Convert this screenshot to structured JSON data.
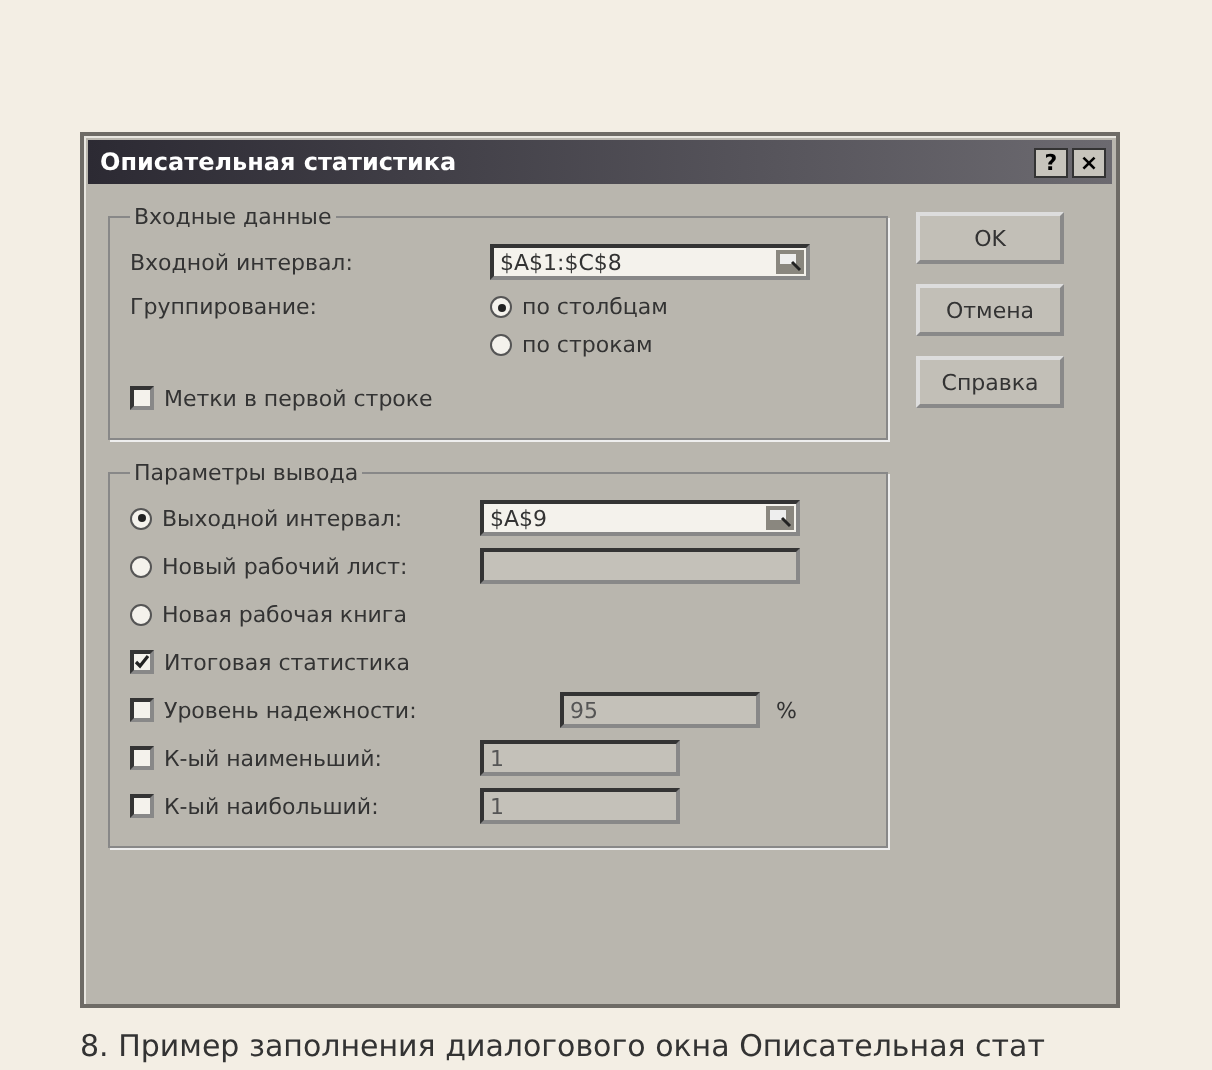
{
  "window": {
    "title": "Описательная статистика",
    "title_buttons": [
      "?",
      "×"
    ]
  },
  "input_group": {
    "title": "Входные данные",
    "range": {
      "label": "Входной интервал:",
      "value": "$A$1:$C$8"
    },
    "grouping": {
      "label": "Группирование:",
      "options": [
        {
          "label": "по столбцам",
          "selected": true
        },
        {
          "label": "по строкам",
          "selected": false
        }
      ]
    },
    "labels_checkbox": {
      "label": "Метки в первой строке",
      "checked": false
    }
  },
  "output_group": {
    "title": "Параметры вывода",
    "items": [
      {
        "kind": "radio",
        "label": "Выходной интервал:",
        "selected": true,
        "field": {
          "value": "$A$9",
          "disabled": false,
          "ref": true
        }
      },
      {
        "kind": "radio",
        "label": "Новый рабочий лист:",
        "selected": false,
        "field": {
          "disabled": true,
          "ref": false
        }
      },
      {
        "kind": "radio",
        "label": "Новая рабочая книга",
        "selected": false
      },
      {
        "kind": "checkbox",
        "label": "Итоговая статистика",
        "checked": true
      },
      {
        "kind": "checkbox",
        "label": "Уровень надежности:",
        "checked": false,
        "field": {
          "value": "95",
          "disabled": true,
          "ref": false,
          "suffix": "%"
        }
      },
      {
        "kind": "checkbox",
        "label": "К-ый наименьший:",
        "checked": false,
        "field": {
          "value": "1",
          "disabled": true,
          "ref": false
        }
      },
      {
        "kind": "checkbox",
        "label": "К-ый наибольший:",
        "checked": false,
        "field": {
          "value": "1",
          "disabled": true,
          "ref": false
        }
      }
    ]
  },
  "buttons": [
    "OK",
    "Отмена",
    "Справка"
  ],
  "caption": "8. Пример заполнения диалогового окна Описательная стат"
}
